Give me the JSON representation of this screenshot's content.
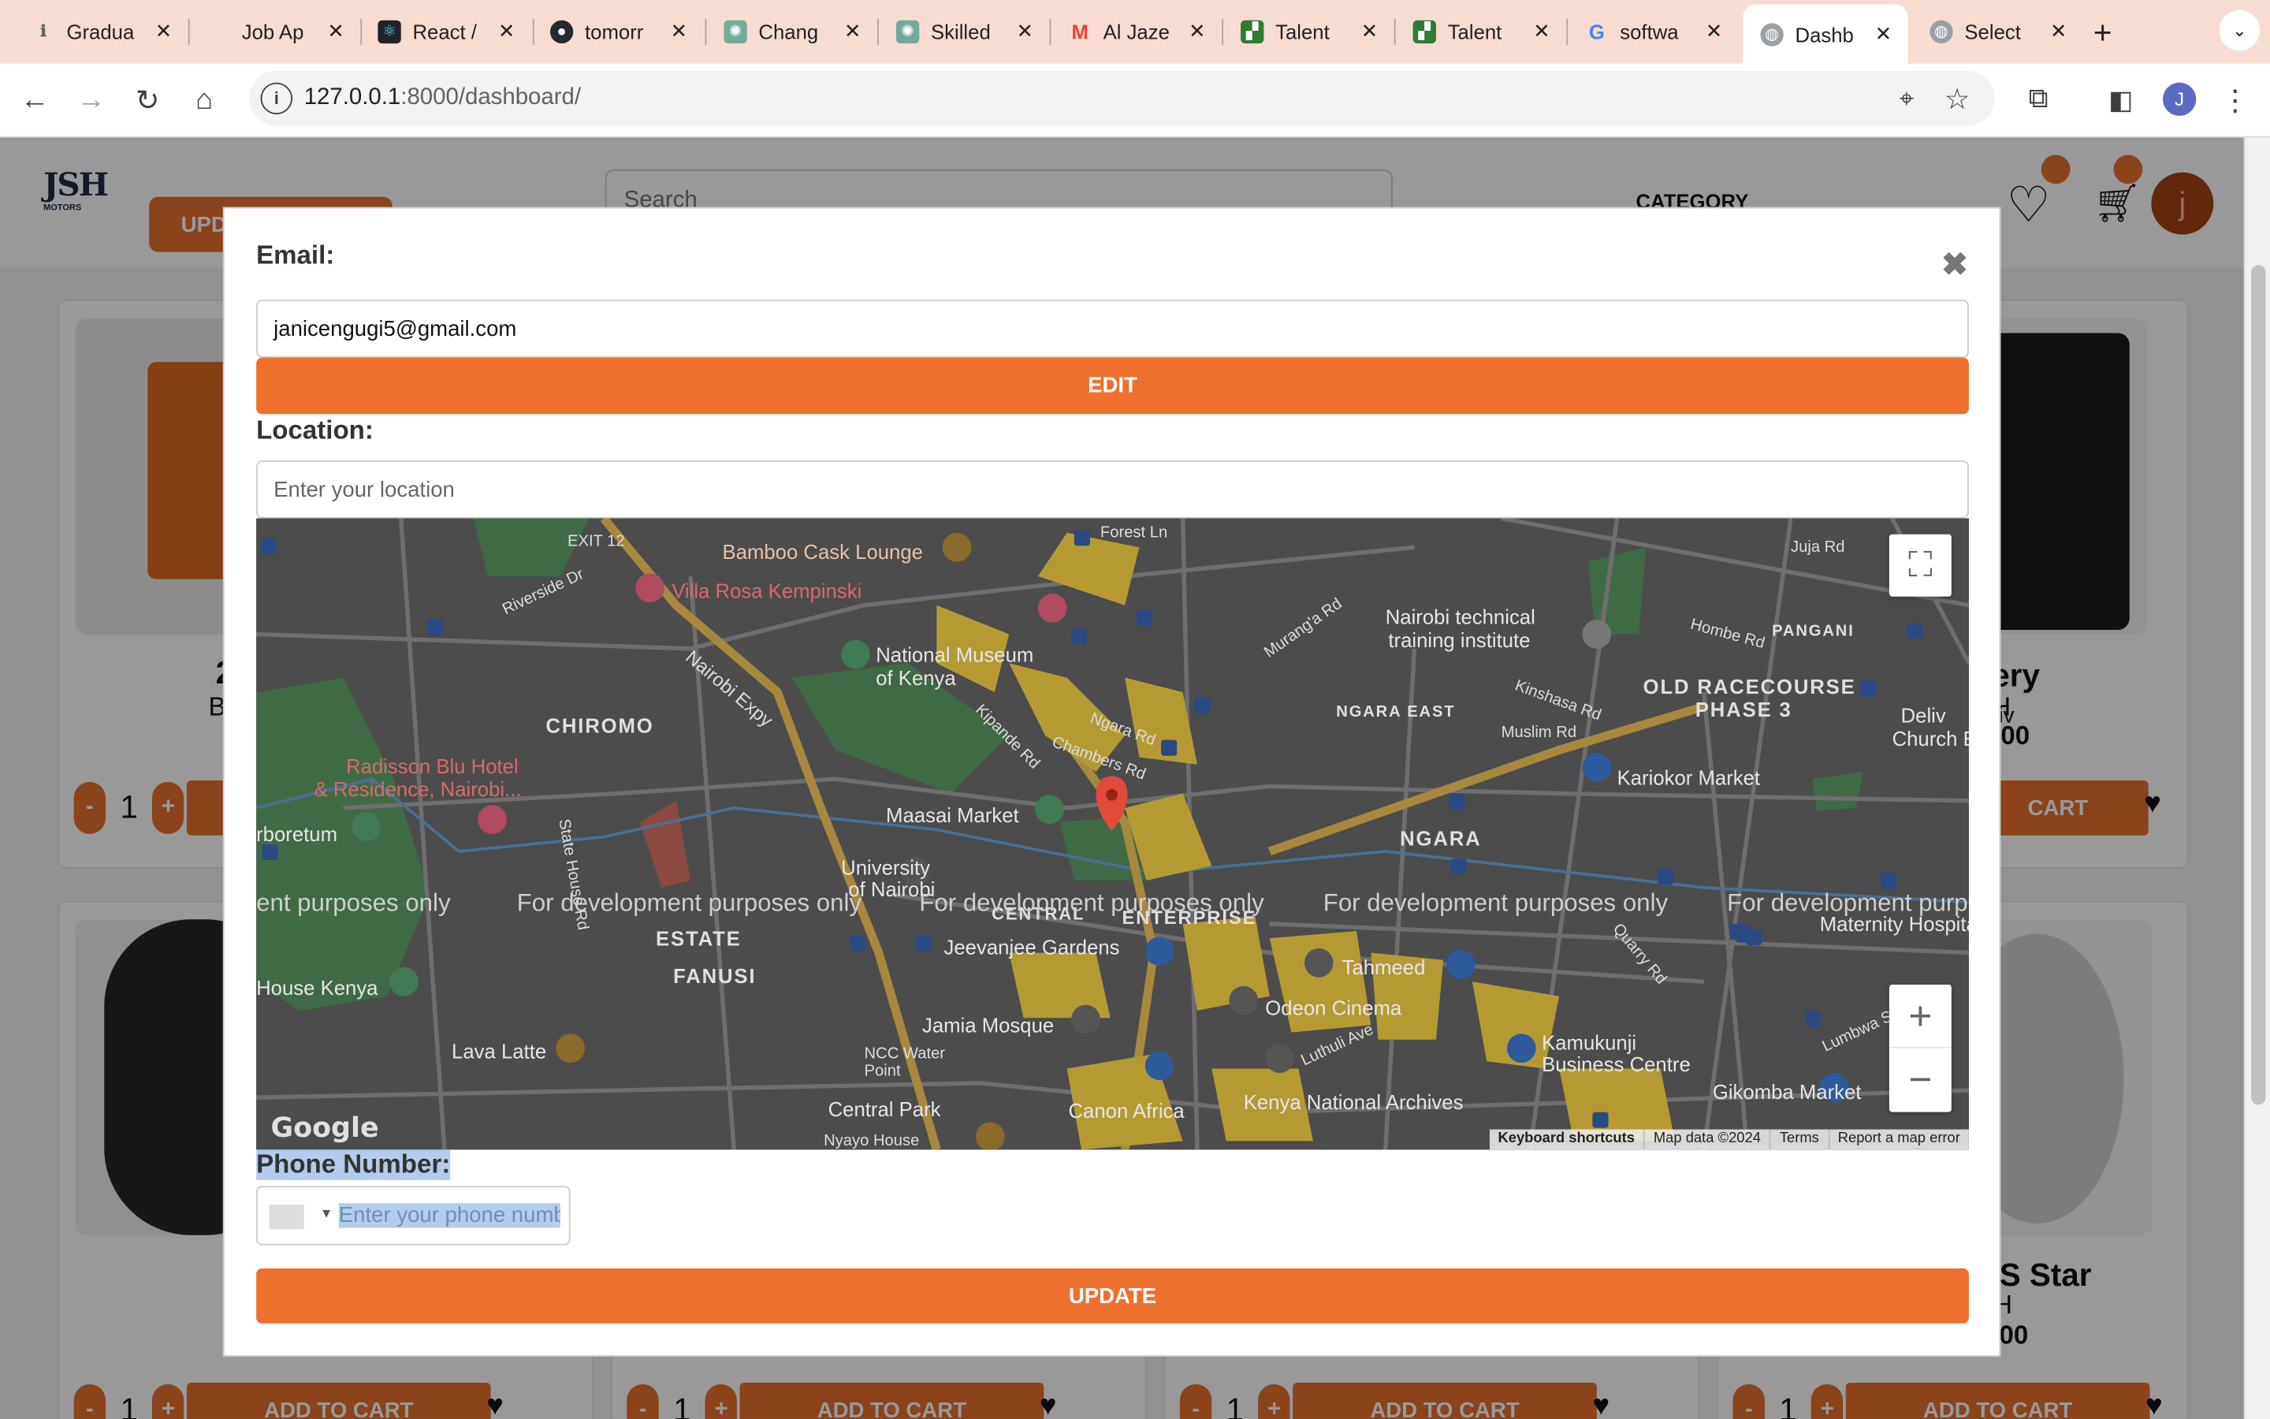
{
  "browser": {
    "tabs": [
      {
        "title": "Gradua",
        "icon": "info-icon",
        "color": "#5f6368"
      },
      {
        "title": "Job Ap",
        "icon": "blank-icon",
        "color": "#999999"
      },
      {
        "title": "React /",
        "icon": "react-icon",
        "color": "#20232a"
      },
      {
        "title": "tomorr",
        "icon": "github-icon",
        "color": "#24292f"
      },
      {
        "title": "Chang",
        "icon": "chatgpt-icon",
        "color": "#74aa9c"
      },
      {
        "title": "Skilled",
        "icon": "chatgpt-icon",
        "color": "#74aa9c"
      },
      {
        "title": "Al Jaze",
        "icon": "gmail-icon",
        "color": "#ea4335"
      },
      {
        "title": "Talent",
        "icon": "talent-icon",
        "color": "#2e7d32"
      },
      {
        "title": "Talent",
        "icon": "talent-icon",
        "color": "#2e7d32"
      },
      {
        "title": "softwa",
        "icon": "google-icon",
        "color": "#4285f4"
      },
      {
        "title": "Dashb",
        "icon": "globe-icon",
        "color": "#9aa0a6",
        "active": true
      },
      {
        "title": "Select",
        "icon": "globe-icon",
        "color": "#9aa0a6"
      }
    ],
    "url_host": "127.0.0.1",
    "url_rest": ":8000/dashboard/",
    "profile_initial": "J"
  },
  "site": {
    "update_label": "UPD",
    "search_placeholder": "Search",
    "category_label": "CATEGORY",
    "user_initial": "j",
    "accent": "#e8712f"
  },
  "products": {
    "row1_left_title": "2",
    "row1_left_sub": "B",
    "row1_right_title": "ery",
    "row1_right_sub": "H",
    "row1_right_price": "00",
    "row2_right_title": "/S Star",
    "row2_right_sub": "H",
    "row2_right_price": "00",
    "right_card_church": "Deliv",
    "qty": "1",
    "minus": "-",
    "plus": "+",
    "add_to_cart": "ADD TO CART",
    "cart_short": "CART"
  },
  "modal": {
    "email_label": "Email:",
    "email_value": "janicengugi5@gmail.com",
    "edit_label": "EDIT",
    "location_label": "Location:",
    "location_placeholder": "Enter your location",
    "phone_label": "Phone Number:",
    "phone_placeholder": "Enter your phone numb",
    "update_label": "UPDATE",
    "close_glyph": "✖"
  },
  "map": {
    "dev_text": "For development purposes only",
    "dev_text_left": "ent purposes only",
    "dev_text_right": "For development purpo",
    "google": "Google",
    "attribution": [
      "Keyboard shortcuts",
      "Map data ©2024",
      "Terms",
      "Report a map error"
    ],
    "labels": {
      "bamboo": "Bamboo Cask Lounge",
      "villa": "Villa Rosa Kempinski",
      "museum1": "National Museum",
      "museum2": "of Kenya",
      "chiromo": "CHIROMO",
      "radisson1": "Radisson Blu Hotel",
      "radisson2": "& Residence, Nairobi...",
      "arboretum": "rboretum",
      "maasai": "Maasai Market",
      "university1": "University",
      "university2": "of Nairobi",
      "central": "CENTRAL",
      "enterprise": "ENTERPRISE",
      "estate": "ESTATE",
      "fanusi": "FANUSI",
      "jeevanjee": "Jeevanjee Gardens",
      "jamia": "Jamia Mosque",
      "lavalatte": "Lava Latte",
      "housekenya": "House Kenya",
      "canon": "Canon Africa",
      "centralpark": "Central Park",
      "archives": "Kenya National Archives",
      "tahmeed": "Tahmeed",
      "odeon": "Odeon Cinema",
      "kamukunji1": "Kamukunji",
      "kamukunji2": "Business Centre",
      "gikomba": "Gikomba Market",
      "kariokor": "Kariokor Market",
      "ngara": "NGARA",
      "ngaraeast": "NGARA EAST",
      "racecourse1": "OLD RACECOURSE",
      "racecourse2": "PHASE 3",
      "nti1": "Nairobi technical",
      "nti2": "training institute",
      "pangani": "PANGANI",
      "maternity": "Maternity Hospital",
      "deliverance1": "Deliv",
      "deliverance2": "Church Ea",
      "exit": "EXIT 12",
      "forest": "Forest Ln",
      "murang": "Murang'a Rd",
      "ngararoad": "Ngara Rd",
      "chambers": "Chambers Rd",
      "kipande": "Kipande Rd",
      "expy": "Nairobi Expy",
      "riverside": "Riverside Dr",
      "statehouse": "State House Rd",
      "kinshasa": "Kinshasa Rd",
      "muslim": "Muslim Rd",
      "homberd": "Hombe Rd",
      "jujard": "Juja Rd",
      "ncc1": "NCC Water",
      "ncc2": "Point",
      "nyayo": "Nyayo House",
      "luthuli": "Luthuli Ave",
      "lumbwa": "Lumbwa St",
      "quarry": "Quarry Rd"
    }
  }
}
